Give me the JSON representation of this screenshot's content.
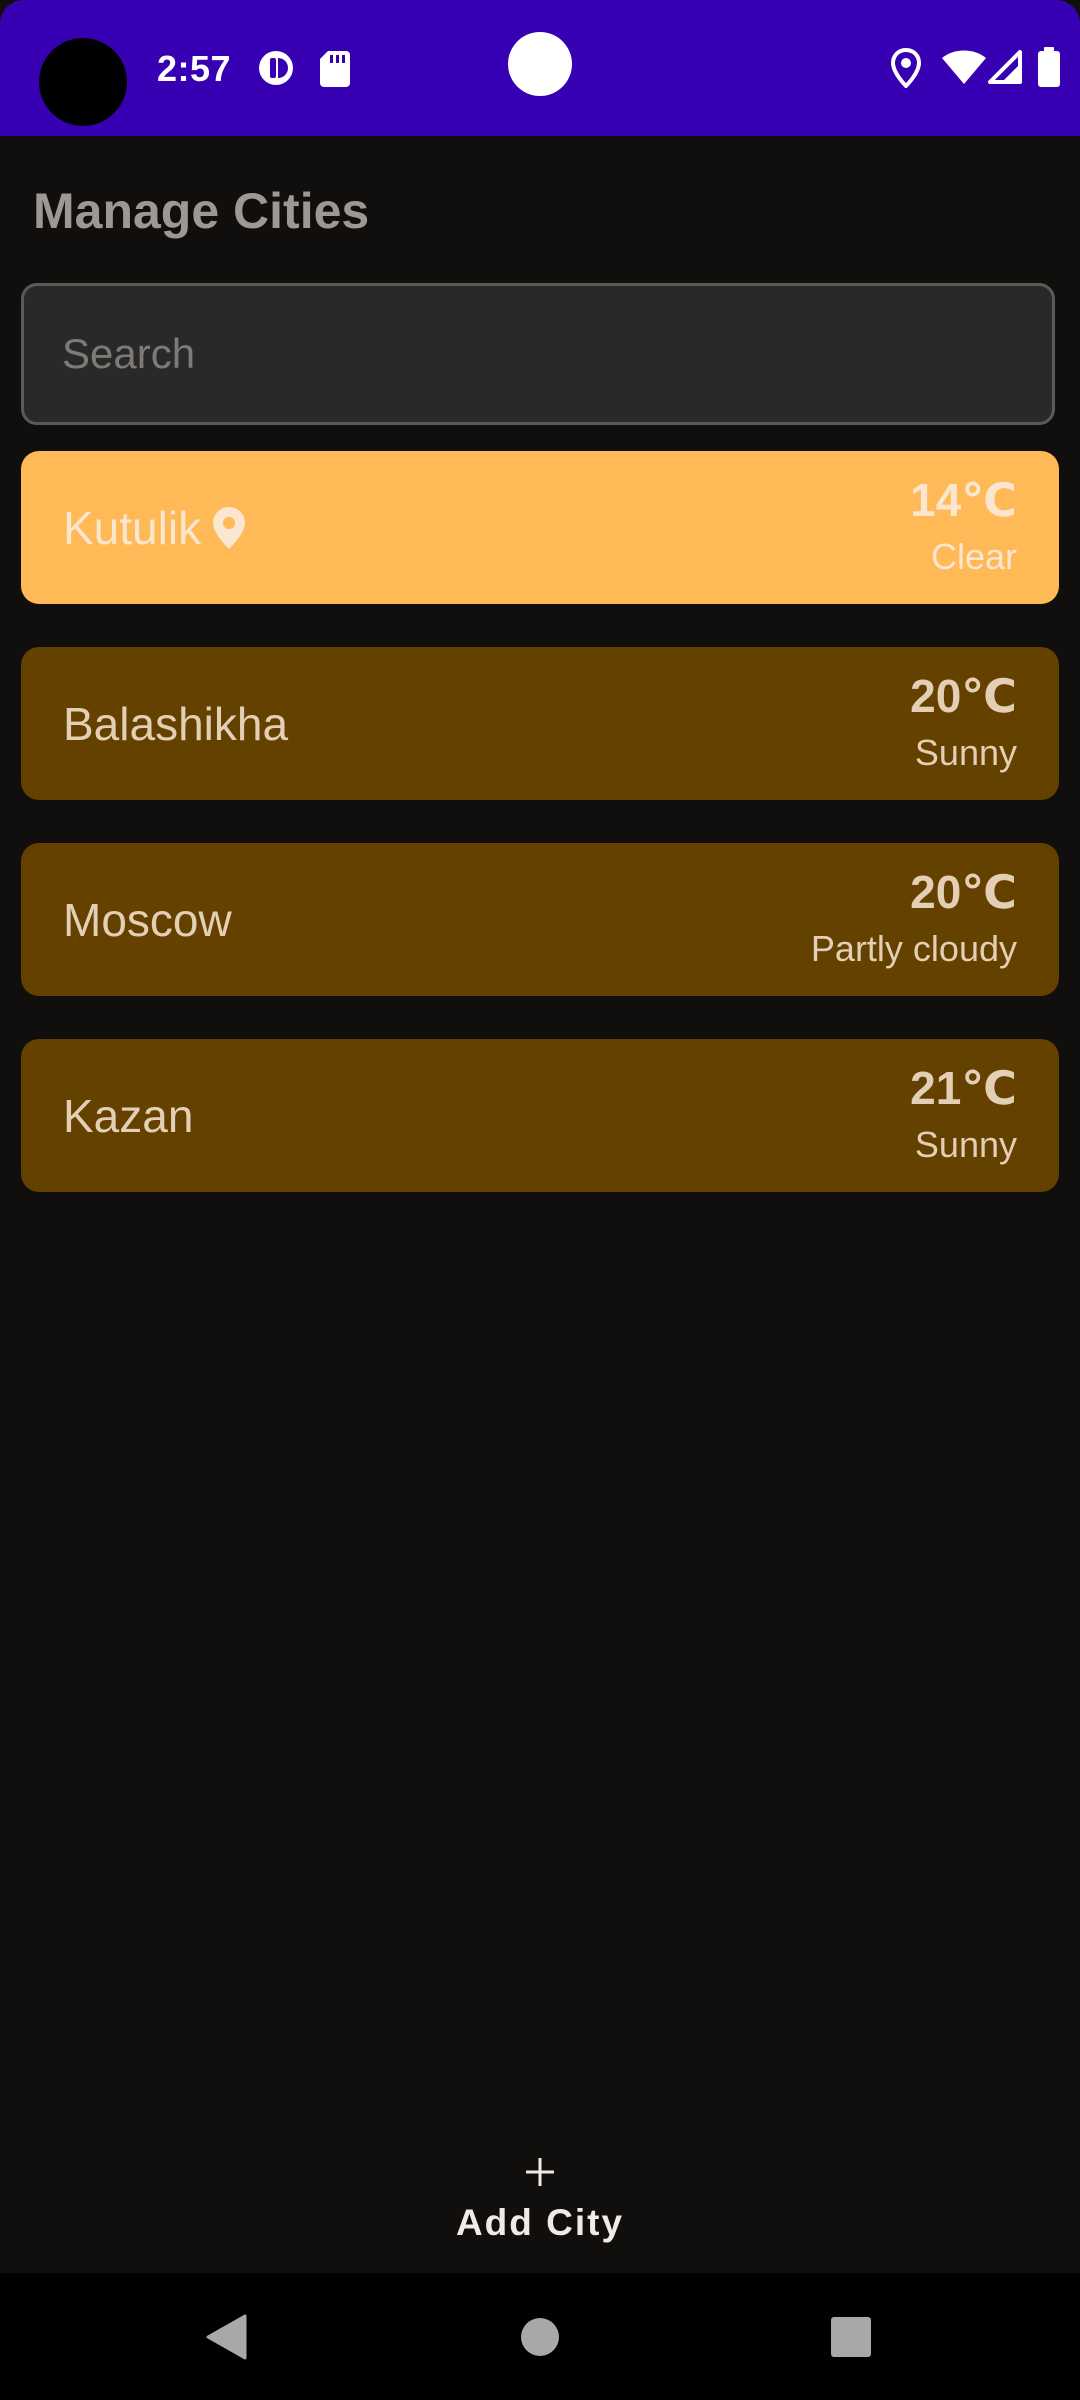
{
  "status_bar": {
    "time": "2:57",
    "bg_color": "#3700b3"
  },
  "header": {
    "title": "Manage Cities"
  },
  "search": {
    "placeholder": "Search",
    "value": ""
  },
  "cities": [
    {
      "name": "Kutulik",
      "temp": "14℃",
      "condition": "Clear",
      "current_location": true
    },
    {
      "name": "Balashikha",
      "temp": "20℃",
      "condition": "Sunny",
      "current_location": false
    },
    {
      "name": "Moscow",
      "temp": "20℃",
      "condition": "Partly cloudy",
      "current_location": false
    },
    {
      "name": "Kazan",
      "temp": "21℃",
      "condition": "Sunny",
      "current_location": false
    }
  ],
  "add_city": {
    "label": "Add City",
    "icon": "plus-icon"
  },
  "nav": {
    "back_icon": "back-triangle-icon",
    "home_icon": "home-circle-icon",
    "recents_icon": "recents-square-icon"
  },
  "colors": {
    "background": "#100f0e",
    "current_card": "#ffb957",
    "card": "#654100",
    "card_text": "#e3cfb6"
  }
}
